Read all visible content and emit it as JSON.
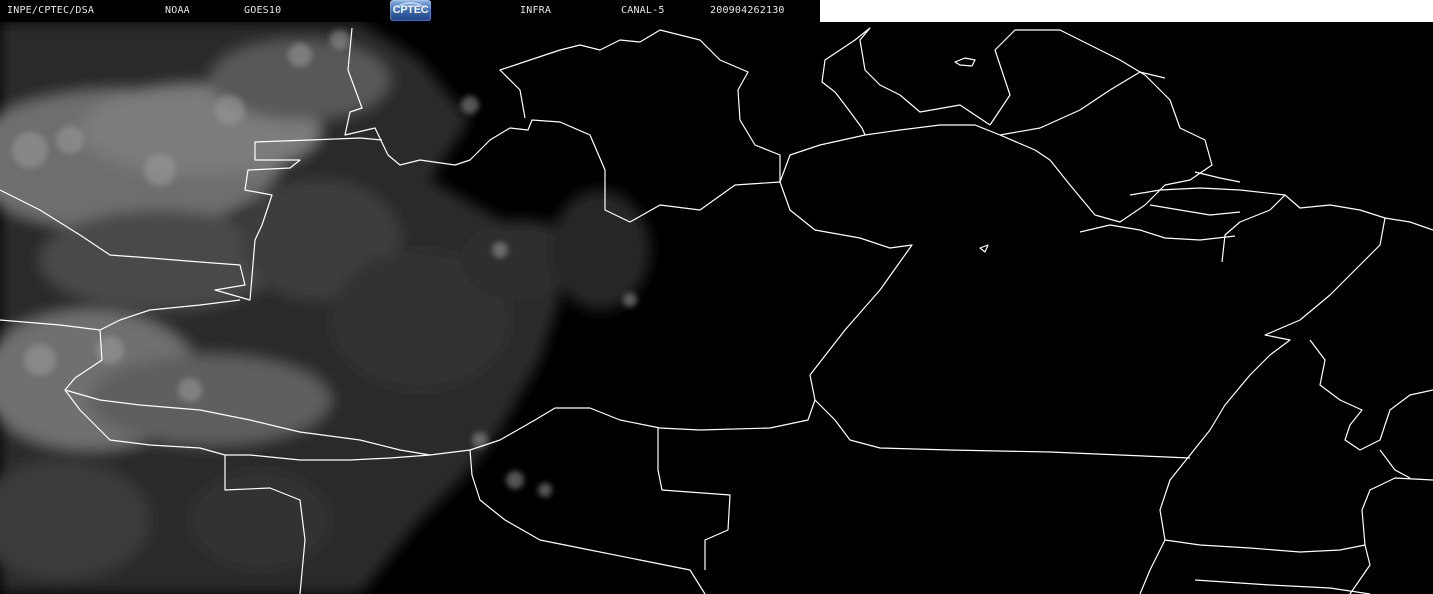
{
  "header": {
    "institution": "INPE/CPTEC/DSA",
    "agency": "NOAA",
    "satellite": "GOES10",
    "logo_text": "CPTEC",
    "product": "INFRA",
    "channel": "CANAL-5",
    "datetime": "200904262130"
  },
  "image": {
    "type": "satellite-infrared-image",
    "border_color": "#ffffff",
    "background_color": "#000000",
    "cloud_color": "#8a8a8a"
  }
}
